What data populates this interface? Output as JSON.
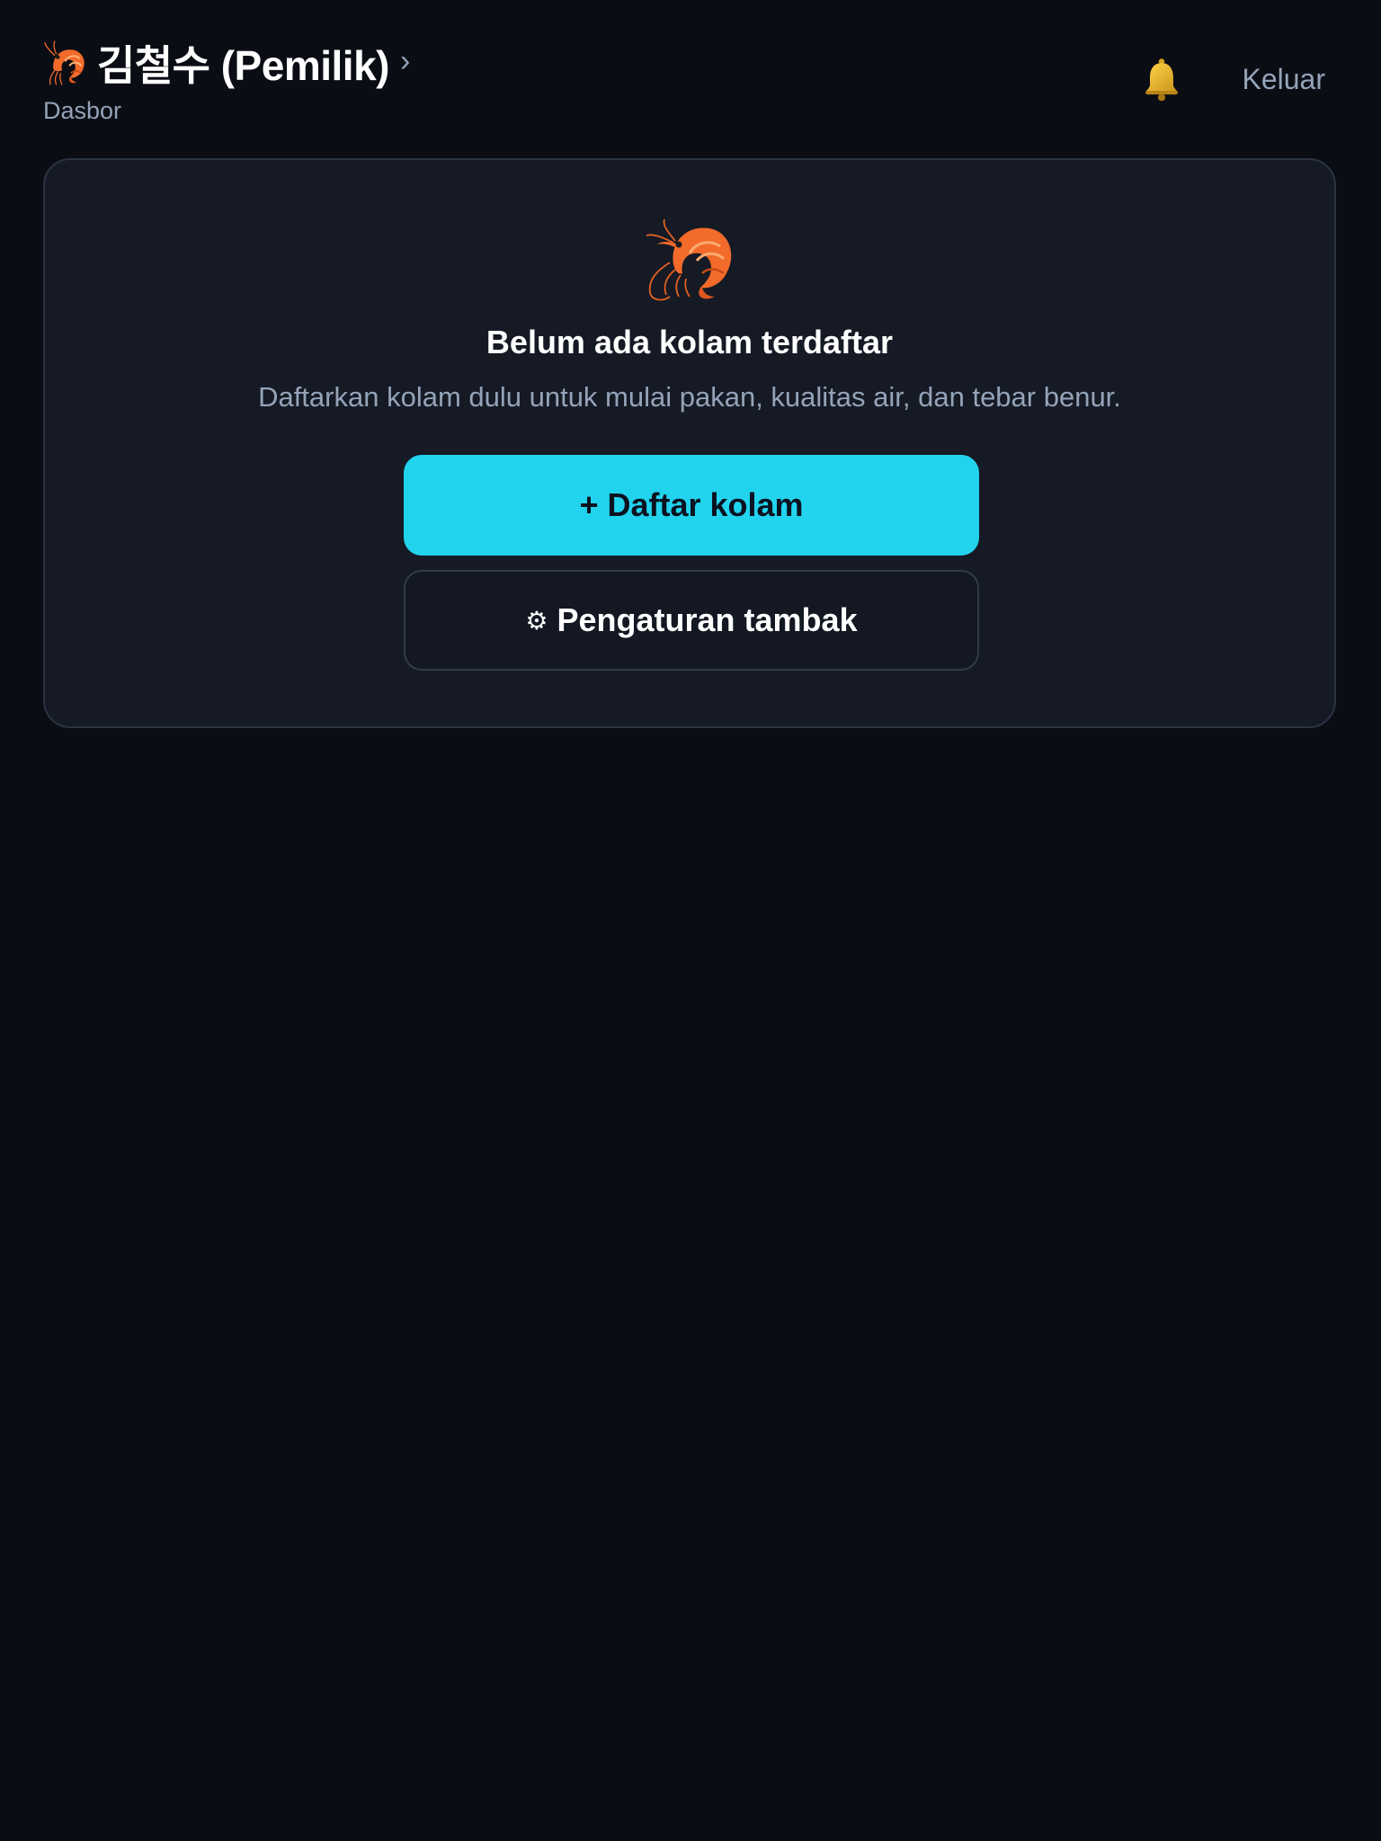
{
  "header": {
    "title": "김철수 (Pemilik)",
    "subtitle": "Dasbor",
    "chevron": "›",
    "logout_label": "Keluar",
    "icons": {
      "brand": "shrimp-icon",
      "notifications": "bell-icon"
    }
  },
  "empty_state": {
    "icon": "shrimp-icon",
    "title": "Belum ada kolam terdaftar",
    "description": "Daftarkan kolam dulu untuk mulai pakan, kualitas air, dan tebar benur.",
    "primary_button_label": "+ Daftar kolam",
    "secondary_button_icon": "⚙",
    "secondary_button_label": "Pengaturan tambak"
  },
  "colors": {
    "background": "#0a0d14",
    "card": "#151a25",
    "accent": "#22d3ee",
    "muted_text": "#94a3b8"
  }
}
